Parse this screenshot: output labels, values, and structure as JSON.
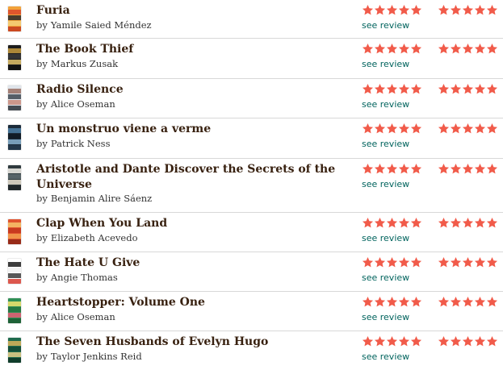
{
  "colors": {
    "star": "#f15b4a",
    "link": "#00635d",
    "title": "#382110",
    "divider": "#d8d8d8"
  },
  "icons": {
    "star": "star-icon"
  },
  "review_label": "see review",
  "by_label": "by",
  "books": [
    {
      "title": "Furia",
      "author": "Yamile Saied Méndez",
      "my_rating": 5,
      "avg_rating": 5,
      "cover_colors": [
        "#f2a23a",
        "#d9492b",
        "#2a2a2a",
        "#f5d07a",
        "#c43a1d"
      ]
    },
    {
      "title": "The Book Thief",
      "author": "Markus Zusak",
      "my_rating": 5,
      "avg_rating": 5,
      "cover_colors": [
        "#1d1d1d",
        "#c59a3d",
        "#3a3a3a",
        "#e2c26b",
        "#111111"
      ]
    },
    {
      "title": "Radio Silence",
      "author": "Alice Oseman",
      "my_rating": 5,
      "avg_rating": 5,
      "cover_colors": [
        "#dfe4ea",
        "#9a6f61",
        "#3d4650",
        "#c98a7a",
        "#2c3138"
      ]
    },
    {
      "title": "Un monstruo viene a verme",
      "author": "Patrick Ness",
      "my_rating": 5,
      "avg_rating": 5,
      "cover_colors": [
        "#1b2b3a",
        "#4b7ea5",
        "#0f1a23",
        "#87b2cf",
        "#243b4e"
      ]
    },
    {
      "title": "Aristotle and Dante Discover the Secrets of the Universe",
      "author": "Benjamin Alire Sáenz",
      "my_rating": 5,
      "avg_rating": 5,
      "cover_colors": [
        "#2f3a3e",
        "#f3f1ea",
        "#5e6b6e",
        "#e9e2d1",
        "#1d2427"
      ]
    },
    {
      "title": "Clap When You Land",
      "author": "Elizabeth Acevedo",
      "my_rating": 5,
      "avg_rating": 5,
      "cover_colors": [
        "#e0532f",
        "#f7c46b",
        "#c3361c",
        "#f2a04d",
        "#8b2414"
      ]
    },
    {
      "title": "The Hate U Give",
      "author": "Angie Thomas",
      "my_rating": 5,
      "avg_rating": 5,
      "cover_colors": [
        "#ffffff",
        "#1a1a1a",
        "#f1f1f1",
        "#3a3a3a",
        "#d63a2e"
      ]
    },
    {
      "title": "Heartstopper: Volume One",
      "author": "Alice Oseman",
      "my_rating": 5,
      "avg_rating": 5,
      "cover_colors": [
        "#2f8f56",
        "#f1e56f",
        "#23743f",
        "#e85d75",
        "#1b5a31"
      ]
    },
    {
      "title": "The Seven Husbands of Evelyn Hugo",
      "author": "Taylor Jenkins Reid",
      "my_rating": 5,
      "avg_rating": 5,
      "cover_colors": [
        "#1f6b4d",
        "#d9b45a",
        "#134a35",
        "#e8cf8a",
        "#0e3526"
      ]
    }
  ]
}
